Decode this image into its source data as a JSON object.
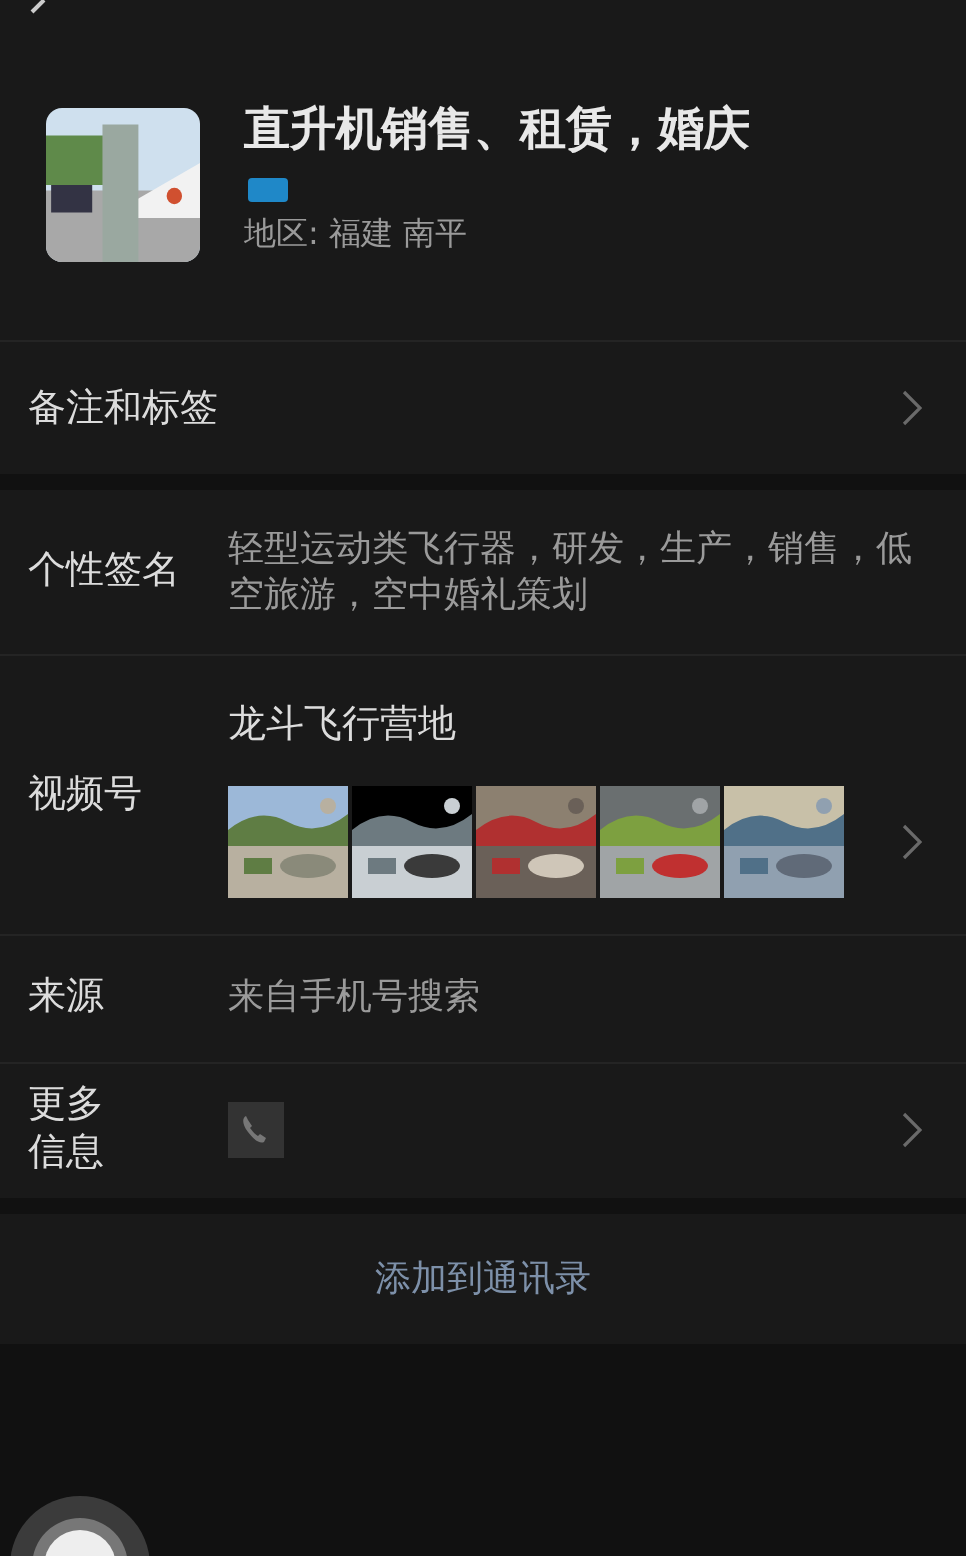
{
  "profile": {
    "name": "直升机销售、租赁，婚庆",
    "region": "地区: 福建 南平"
  },
  "remark_row": {
    "label": "备注和标签"
  },
  "rows": [
    {
      "kind": "text",
      "label": "个性签名",
      "value": "轻型运动类飞行器，研发，生产，销售，低空旅游，空中婚礼策划"
    },
    {
      "kind": "channel",
      "label": "视频号",
      "value": "龙斗飞行营地"
    },
    {
      "kind": "text",
      "label": "来源",
      "value": "来自手机号搜索"
    },
    {
      "kind": "more",
      "label": "更多信息"
    }
  ],
  "action": {
    "label": "添加到通讯录"
  }
}
